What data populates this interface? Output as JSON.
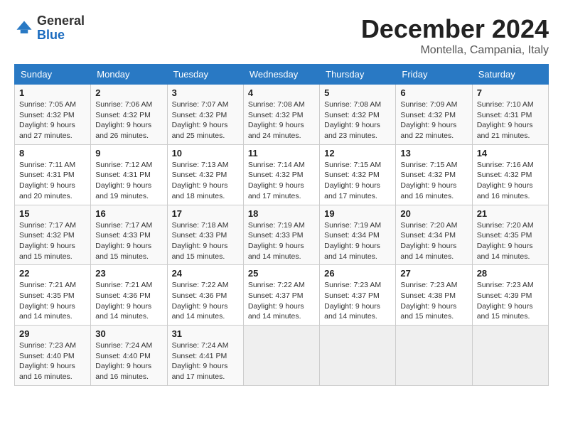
{
  "header": {
    "logo_general": "General",
    "logo_blue": "Blue",
    "month_title": "December 2024",
    "location": "Montella, Campania, Italy"
  },
  "calendar": {
    "days_of_week": [
      "Sunday",
      "Monday",
      "Tuesday",
      "Wednesday",
      "Thursday",
      "Friday",
      "Saturday"
    ],
    "weeks": [
      [
        {
          "day": "1",
          "sunrise": "7:05 AM",
          "sunset": "4:32 PM",
          "daylight": "9 hours and 27 minutes."
        },
        {
          "day": "2",
          "sunrise": "7:06 AM",
          "sunset": "4:32 PM",
          "daylight": "9 hours and 26 minutes."
        },
        {
          "day": "3",
          "sunrise": "7:07 AM",
          "sunset": "4:32 PM",
          "daylight": "9 hours and 25 minutes."
        },
        {
          "day": "4",
          "sunrise": "7:08 AM",
          "sunset": "4:32 PM",
          "daylight": "9 hours and 24 minutes."
        },
        {
          "day": "5",
          "sunrise": "7:08 AM",
          "sunset": "4:32 PM",
          "daylight": "9 hours and 23 minutes."
        },
        {
          "day": "6",
          "sunrise": "7:09 AM",
          "sunset": "4:32 PM",
          "daylight": "9 hours and 22 minutes."
        },
        {
          "day": "7",
          "sunrise": "7:10 AM",
          "sunset": "4:31 PM",
          "daylight": "9 hours and 21 minutes."
        }
      ],
      [
        {
          "day": "8",
          "sunrise": "7:11 AM",
          "sunset": "4:31 PM",
          "daylight": "9 hours and 20 minutes."
        },
        {
          "day": "9",
          "sunrise": "7:12 AM",
          "sunset": "4:31 PM",
          "daylight": "9 hours and 19 minutes."
        },
        {
          "day": "10",
          "sunrise": "7:13 AM",
          "sunset": "4:32 PM",
          "daylight": "9 hours and 18 minutes."
        },
        {
          "day": "11",
          "sunrise": "7:14 AM",
          "sunset": "4:32 PM",
          "daylight": "9 hours and 17 minutes."
        },
        {
          "day": "12",
          "sunrise": "7:15 AM",
          "sunset": "4:32 PM",
          "daylight": "9 hours and 17 minutes."
        },
        {
          "day": "13",
          "sunrise": "7:15 AM",
          "sunset": "4:32 PM",
          "daylight": "9 hours and 16 minutes."
        },
        {
          "day": "14",
          "sunrise": "7:16 AM",
          "sunset": "4:32 PM",
          "daylight": "9 hours and 16 minutes."
        }
      ],
      [
        {
          "day": "15",
          "sunrise": "7:17 AM",
          "sunset": "4:32 PM",
          "daylight": "9 hours and 15 minutes."
        },
        {
          "day": "16",
          "sunrise": "7:17 AM",
          "sunset": "4:33 PM",
          "daylight": "9 hours and 15 minutes."
        },
        {
          "day": "17",
          "sunrise": "7:18 AM",
          "sunset": "4:33 PM",
          "daylight": "9 hours and 15 minutes."
        },
        {
          "day": "18",
          "sunrise": "7:19 AM",
          "sunset": "4:33 PM",
          "daylight": "9 hours and 14 minutes."
        },
        {
          "day": "19",
          "sunrise": "7:19 AM",
          "sunset": "4:34 PM",
          "daylight": "9 hours and 14 minutes."
        },
        {
          "day": "20",
          "sunrise": "7:20 AM",
          "sunset": "4:34 PM",
          "daylight": "9 hours and 14 minutes."
        },
        {
          "day": "21",
          "sunrise": "7:20 AM",
          "sunset": "4:35 PM",
          "daylight": "9 hours and 14 minutes."
        }
      ],
      [
        {
          "day": "22",
          "sunrise": "7:21 AM",
          "sunset": "4:35 PM",
          "daylight": "9 hours and 14 minutes."
        },
        {
          "day": "23",
          "sunrise": "7:21 AM",
          "sunset": "4:36 PM",
          "daylight": "9 hours and 14 minutes."
        },
        {
          "day": "24",
          "sunrise": "7:22 AM",
          "sunset": "4:36 PM",
          "daylight": "9 hours and 14 minutes."
        },
        {
          "day": "25",
          "sunrise": "7:22 AM",
          "sunset": "4:37 PM",
          "daylight": "9 hours and 14 minutes."
        },
        {
          "day": "26",
          "sunrise": "7:23 AM",
          "sunset": "4:37 PM",
          "daylight": "9 hours and 14 minutes."
        },
        {
          "day": "27",
          "sunrise": "7:23 AM",
          "sunset": "4:38 PM",
          "daylight": "9 hours and 15 minutes."
        },
        {
          "day": "28",
          "sunrise": "7:23 AM",
          "sunset": "4:39 PM",
          "daylight": "9 hours and 15 minutes."
        }
      ],
      [
        {
          "day": "29",
          "sunrise": "7:23 AM",
          "sunset": "4:40 PM",
          "daylight": "9 hours and 16 minutes."
        },
        {
          "day": "30",
          "sunrise": "7:24 AM",
          "sunset": "4:40 PM",
          "daylight": "9 hours and 16 minutes."
        },
        {
          "day": "31",
          "sunrise": "7:24 AM",
          "sunset": "4:41 PM",
          "daylight": "9 hours and 17 minutes."
        },
        null,
        null,
        null,
        null
      ]
    ]
  }
}
